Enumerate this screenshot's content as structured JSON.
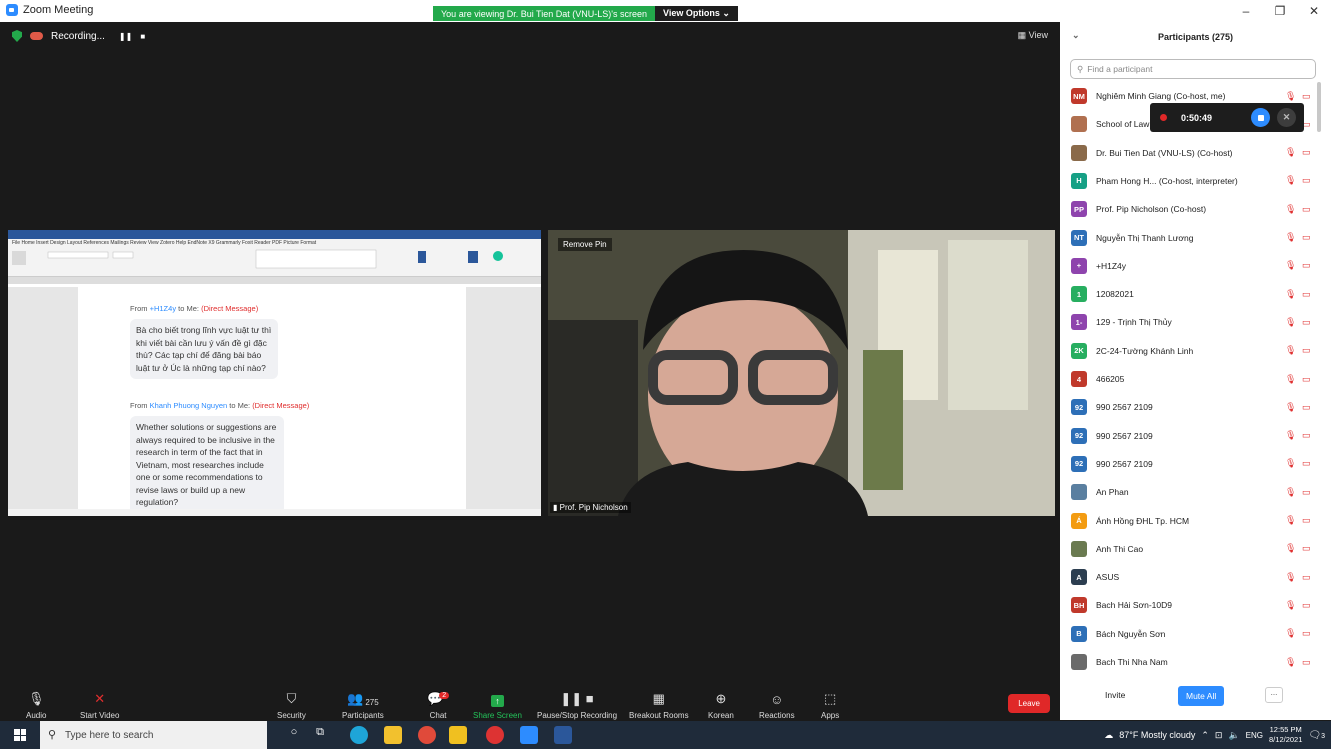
{
  "window": {
    "title": "Zoom Meeting",
    "minimize": "–",
    "restore": "❐",
    "close": "✕"
  },
  "share_banner": {
    "message": "You are viewing Dr. Bui Tien Dat (VNU-LS)'s screen",
    "view_options": "View Options ⌄"
  },
  "recording": {
    "label": "Recording...",
    "pause": "❚❚",
    "stop": "■"
  },
  "view_button": "▦ View",
  "shared_screen": {
    "messages": [
      {
        "from": "From ",
        "sender": "+H1Z4y",
        "to": " to Me: ",
        "type": "(Direct Message)",
        "text": "Bà cho biết trong lĩnh vực luật tư thì khi viết bài cần lưu ý vấn đề gì đặc thù? Các tạp chí để đăng bài báo luật tư ở Úc là những tạp chí nào?"
      },
      {
        "from": "From ",
        "sender": "Khanh Phuong Nguyen",
        "to": " to Me: ",
        "type": "(Direct Message)",
        "text": "Whether solutions or suggestions are always required to be inclusive in the research in term of the fact that in Vietnam, most researches include one or some recommendations to revise laws  or  build up a new regulation?"
      }
    ],
    "menu": "File   Home   Insert   Design   Layout   References   Mailings   Review   View   Zotero   Help   EndNote X9   Grammarly   Foxit Reader PDF   Picture Format"
  },
  "video": {
    "remove_pin": "Remove Pin",
    "speaker_name": "Prof. Pip Nicholson"
  },
  "toolbar": {
    "audio": "Audio",
    "start_video": "Start Video",
    "security": "Security",
    "participants": "Participants",
    "participants_count": "275",
    "chat": "Chat",
    "chat_badge": "2",
    "share_screen": "Share Screen",
    "pause_stop_recording": "Pause/Stop Recording",
    "breakout_rooms": "Breakout Rooms",
    "korean": "Korean",
    "reactions": "Reactions",
    "apps": "Apps",
    "leave": "Leave"
  },
  "panel": {
    "title": "Participants (275)",
    "search_placeholder": "Find a participant",
    "participants": [
      {
        "initials": "NM",
        "name": "Nghiêm Minh Giang (Co-host, me)",
        "color": "#c0392b"
      },
      {
        "initials": "",
        "name": "School of Law",
        "color": "#b07050"
      },
      {
        "initials": "",
        "name": "Dr. Bui Tien Dat (VNU-LS) (Co-host)",
        "color": "#8a6a4a"
      },
      {
        "initials": "H",
        "name": "Pham Hong H... (Co-host, interpreter)",
        "color": "#16a085"
      },
      {
        "initials": "PP",
        "name": "Prof. Pip Nicholson (Co-host)",
        "color": "#8e44ad"
      },
      {
        "initials": "NT",
        "name": "Nguyễn Thị Thanh Lương",
        "color": "#2d6fb7"
      },
      {
        "initials": "+",
        "name": "+H1Z4y",
        "color": "#8e44ad"
      },
      {
        "initials": "1",
        "name": "12082021",
        "color": "#27ae60"
      },
      {
        "initials": "1-",
        "name": "129 - Trịnh Thị Thủy",
        "color": "#8e44ad"
      },
      {
        "initials": "2K",
        "name": "2C-24-Tường Khánh Linh",
        "color": "#27ae60"
      },
      {
        "initials": "4",
        "name": "466205",
        "color": "#c0392b"
      },
      {
        "initials": "92",
        "name": "990 2567 2109",
        "color": "#2d6fb7"
      },
      {
        "initials": "92",
        "name": "990 2567 2109",
        "color": "#2d6fb7"
      },
      {
        "initials": "92",
        "name": "990 2567 2109",
        "color": "#2d6fb7"
      },
      {
        "initials": "",
        "name": "An Phan",
        "color": "#5a7fa0"
      },
      {
        "initials": "Á",
        "name": "Ánh Hồng ĐHL Tp. HCM",
        "color": "#f39c12"
      },
      {
        "initials": "",
        "name": "Anh Thi Cao",
        "color": "#6a7a50"
      },
      {
        "initials": "A",
        "name": "ASUS",
        "color": "#2c3e50"
      },
      {
        "initials": "BH",
        "name": "Bach Hải Sơn-10D9",
        "color": "#c0392b"
      },
      {
        "initials": "B",
        "name": "Bách Nguyễn Sơn",
        "color": "#2d6fb7"
      },
      {
        "initials": "",
        "name": "Bach Thi Nha Nam",
        "color": "#6a6a6a"
      }
    ],
    "invite": "Invite",
    "mute_all": "Mute All",
    "more": "..."
  },
  "rec_timer": {
    "time": "0:50:49"
  },
  "taskbar": {
    "search_placeholder": "Type here to search",
    "weather": "87°F  Mostly cloudy",
    "lang": "ENG",
    "time": "12:55 PM",
    "date": "8/12/2021",
    "notif": "3"
  }
}
